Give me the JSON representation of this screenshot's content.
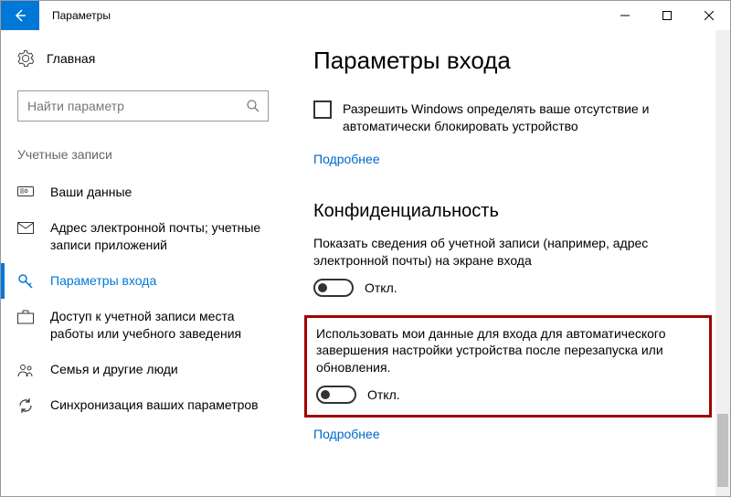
{
  "window": {
    "title": "Параметры"
  },
  "sidebar": {
    "home_label": "Главная",
    "search_placeholder": "Найти параметр",
    "section_header": "Учетные записи",
    "items": [
      {
        "label": "Ваши данные"
      },
      {
        "label": "Адрес электронной почты; учетные записи приложений"
      },
      {
        "label": "Параметры входа"
      },
      {
        "label": "Доступ к учетной записи места работы или учебного заведения"
      },
      {
        "label": "Семья и другие люди"
      },
      {
        "label": "Синхронизация ваших параметров"
      }
    ]
  },
  "main": {
    "page_title": "Параметры входа",
    "checkbox_label": "Разрешить Windows определять ваше отсутствие и автоматически блокировать устройство",
    "link_more_1": "Подробнее",
    "privacy_heading": "Конфиденциальность",
    "setting1_text": "Показать сведения об учетной записи (например, адрес электронной почты) на экране входа",
    "toggle1_label": "Откл.",
    "setting2_text": "Использовать мои данные для входа для автоматического завершения настройки устройства после перезапуска или обновления.",
    "toggle2_label": "Откл.",
    "link_more_2": "Подробнее"
  }
}
